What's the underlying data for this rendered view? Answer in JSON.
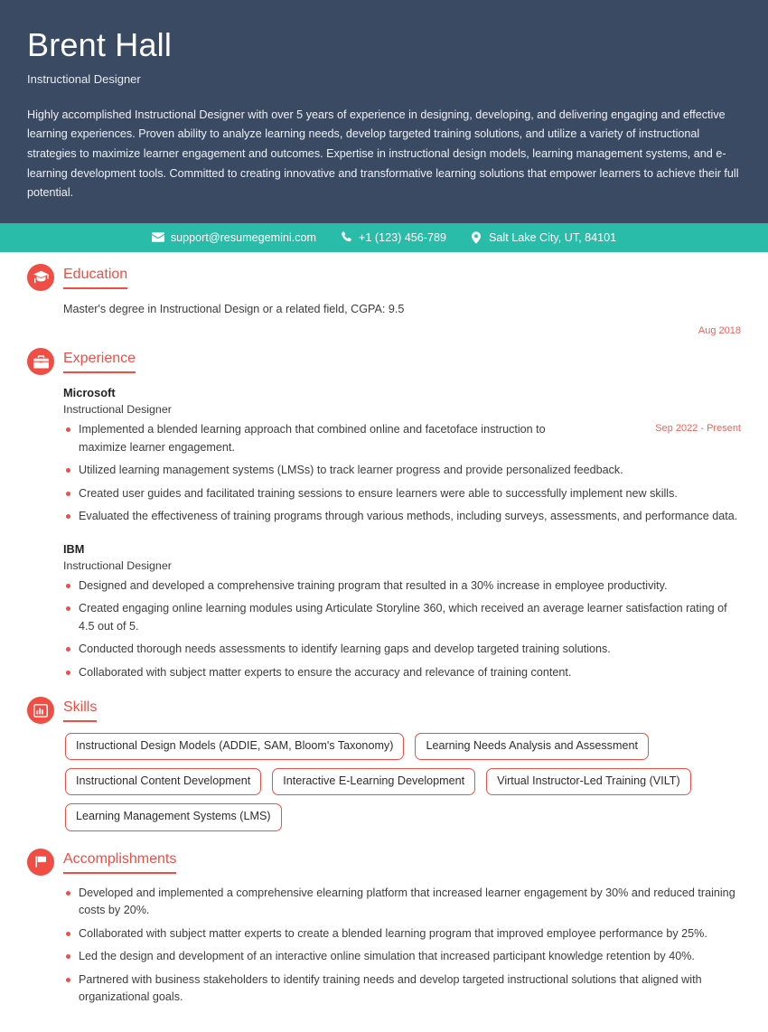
{
  "header": {
    "name": "Brent Hall",
    "designation": "Instructional Designer",
    "summary": "Highly accomplished Instructional Designer with over 5 years of experience in designing, developing, and delivering engaging and effective learning experiences. Proven ability to analyze learning needs, develop targeted training solutions, and utilize a variety of instructional strategies to maximize learner engagement and outcomes. Expertise in instructional design models, learning management systems, and e-learning development tools. Committed to creating innovative and transformative learning solutions that empower learners to achieve their full potential."
  },
  "contact": {
    "email": "support@resumegemini.com",
    "phone": "+1 (123) 456-789",
    "location": "Salt Lake City, UT, 84101",
    "email_icon": "envelope-icon",
    "phone_icon": "phone-icon",
    "location_icon": "map-pin-icon"
  },
  "sections": {
    "education": {
      "title": "Education",
      "icon": "graduation-cap-icon",
      "degree": "Master's degree in Instructional Design or a related field, CGPA: 9.5",
      "date": "Aug 2018"
    },
    "experience": {
      "title": "Experience",
      "icon": "briefcase-icon",
      "jobs": [
        {
          "company": "Microsoft",
          "role": "Instructional Designer",
          "date": "Sep 2022 - Present",
          "bullets": [
            "Implemented a blended learning approach that combined online and facetoface instruction to maximize learner engagement.",
            "Utilized learning management systems (LMSs) to track learner progress and provide personalized feedback.",
            "Created user guides and facilitated training sessions to ensure learners were able to successfully implement new skills.",
            "Evaluated the effectiveness of training programs through various methods, including surveys, assessments, and performance data."
          ]
        },
        {
          "company": "IBM",
          "role": "Instructional Designer",
          "date": "",
          "bullets": [
            "Designed and developed a comprehensive training program that resulted in a 30% increase in employee productivity.",
            "Created engaging online learning modules using Articulate Storyline 360, which received an average learner satisfaction rating of 4.5 out of 5.",
            "Conducted thorough needs assessments to identify learning gaps and develop targeted training solutions.",
            "Collaborated with subject matter experts to ensure the accuracy and relevance of training content."
          ]
        }
      ]
    },
    "skills": {
      "title": "Skills",
      "icon": "bar-chart-icon",
      "items": [
        "Instructional Design Models (ADDIE, SAM, Bloom's Taxonomy)",
        "Learning Needs Analysis and Assessment",
        "Instructional Content Development",
        "Interactive E-Learning Development",
        "Virtual Instructor-Led Training (VILT)",
        "Learning Management Systems (LMS)"
      ]
    },
    "accomplishments": {
      "title": "Accomplishments",
      "icon": "flag-icon",
      "items": [
        "Developed and implemented a comprehensive elearning platform that increased learner engagement by 30% and reduced training costs by 20%.",
        "Collaborated with subject matter experts to create a blended learning program that improved employee performance by 25%.",
        "Led the design and development of an interactive online simulation that increased participant knowledge retention by 40%.",
        "Partnered with business stakeholders to identify training needs and develop targeted instructional solutions that aligned with organizational goals."
      ]
    }
  },
  "colors": {
    "header_bg": "#3a4a63",
    "contact_bg": "#29bca8",
    "accent": "#f04e45",
    "date_text": "#f16159",
    "body_text": "#3c3c3c"
  }
}
